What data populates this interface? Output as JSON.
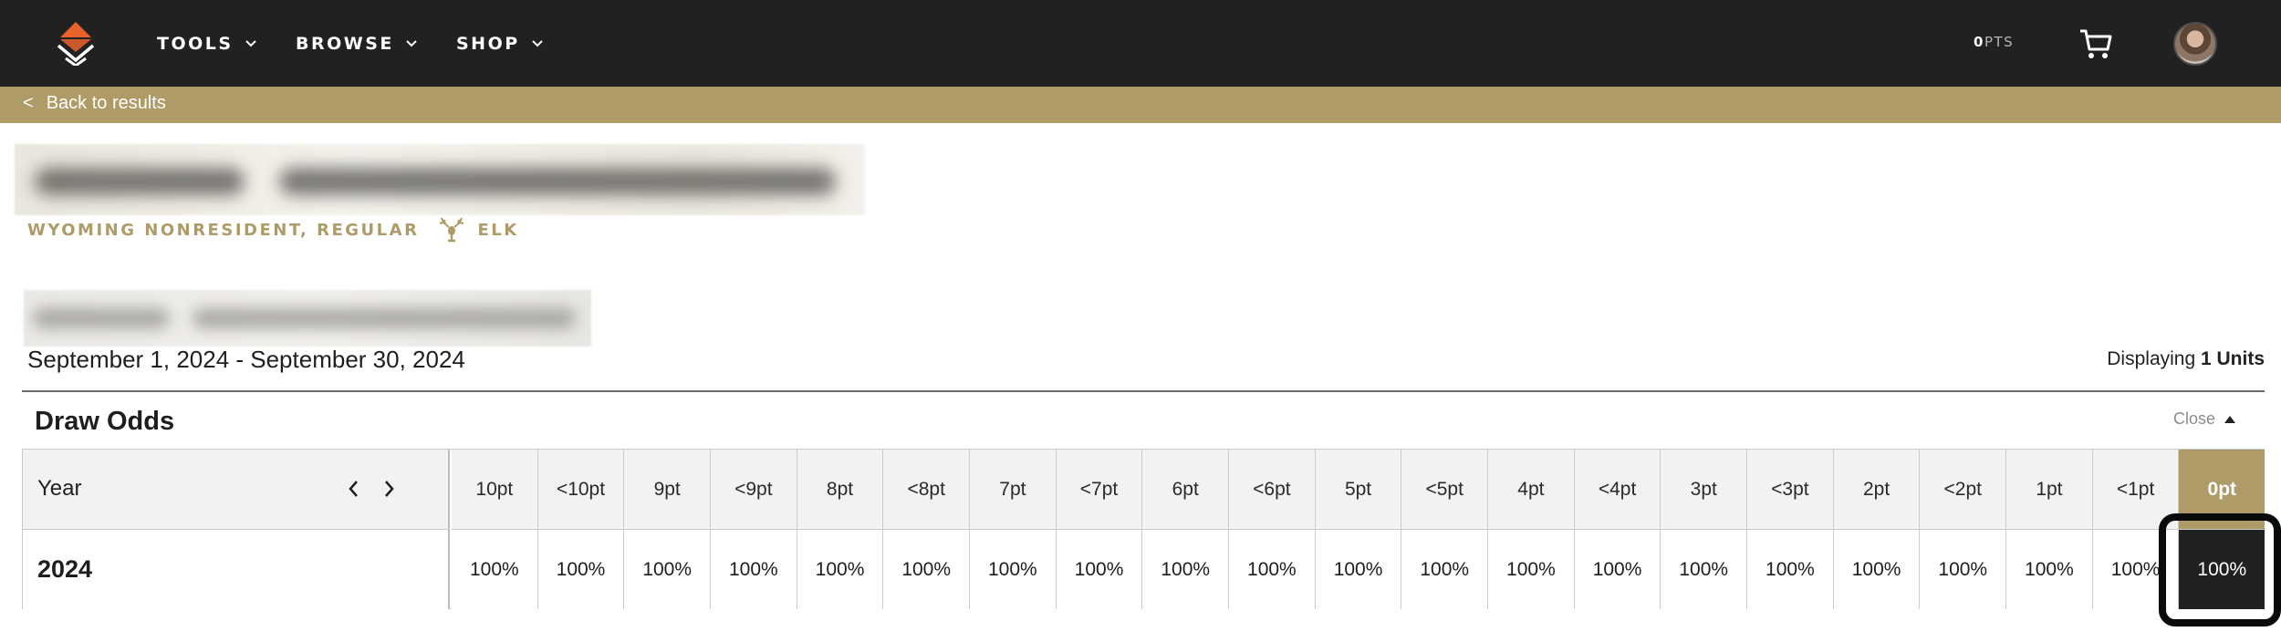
{
  "nav": {
    "items": [
      {
        "label": "TOOLS"
      },
      {
        "label": "BROWSE"
      },
      {
        "label": "SHOP"
      }
    ],
    "points": {
      "value": "0",
      "unit": "PTS"
    },
    "icons": {
      "logo": "brand-logo-icon",
      "cart": "cart-icon",
      "avatar": "user-avatar"
    }
  },
  "back": {
    "arrow": "<",
    "label": "Back to results"
  },
  "hunt": {
    "subtitle": "WYOMING NONRESIDENT, REGULAR",
    "species": "ELK",
    "dates": "September 1, 2024 - September 30, 2024",
    "displaying_prefix": "Displaying ",
    "displaying_count": "1 Units"
  },
  "draw_odds": {
    "title": "Draw Odds",
    "close_label": "Close",
    "year_header": "Year",
    "columns": [
      "10pt",
      "<10pt",
      "9pt",
      "<9pt",
      "8pt",
      "<8pt",
      "7pt",
      "<7pt",
      "6pt",
      "<6pt",
      "5pt",
      "<5pt",
      "4pt",
      "<4pt",
      "3pt",
      "<3pt",
      "2pt",
      "<2pt",
      "1pt",
      "<1pt",
      "0pt"
    ],
    "rows": [
      {
        "year": "2024",
        "values": [
          "100%",
          "100%",
          "100%",
          "100%",
          "100%",
          "100%",
          "100%",
          "100%",
          "100%",
          "100%",
          "100%",
          "100%",
          "100%",
          "100%",
          "100%",
          "100%",
          "100%",
          "100%",
          "100%",
          "100%",
          "100%"
        ]
      }
    ],
    "active_column": "0pt"
  },
  "colors": {
    "nav_bg": "#212121",
    "accent_gold": "#ae9b67",
    "logo_orange": "#e8622c"
  }
}
